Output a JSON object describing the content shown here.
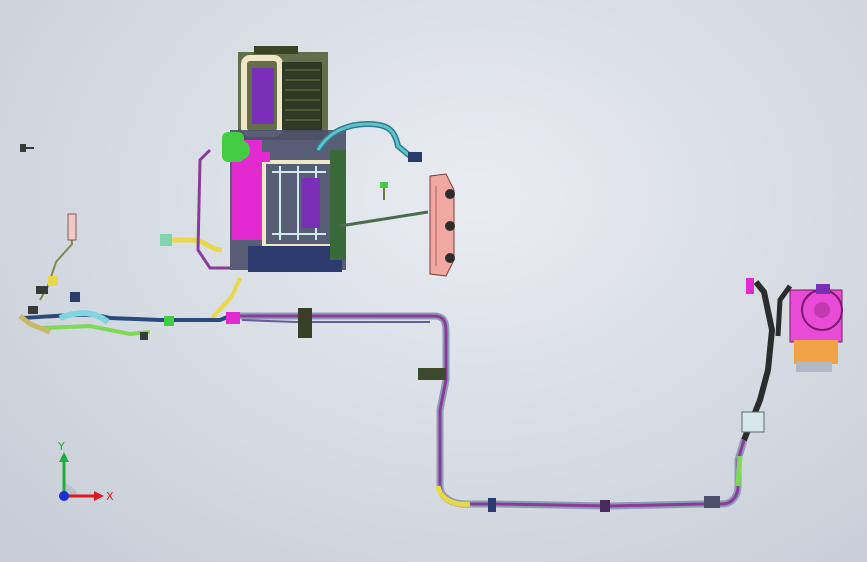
{
  "viewport": {
    "background_top": "#e9edf2",
    "background_bottom": "#c6ccd5"
  },
  "triad": {
    "y_label": "Y",
    "x_label": "X",
    "y_color": "#1fae3a",
    "x_color": "#e0191f",
    "z_color": "#1a2fd6"
  },
  "colors": {
    "hvac_purple": "#7a2fb8",
    "hvac_magenta": "#e22ad0",
    "hvac_green": "#44cc44",
    "hvac_frame": "#efe7c5",
    "pipe_purple": "#8a3c9a",
    "pipe_steel": "#8e9bb5",
    "hose_green": "#7ed957",
    "hose_cyan": "#7fd6e0",
    "compressor_pink": "#e84bd6",
    "compressor_orange": "#f2a345",
    "condenser_salmon": "#f0a8a0",
    "clip_yellow": "#e8d84a"
  },
  "icons": {
    "compressor": "compressor-icon",
    "hvac": "hvac-unit-icon",
    "condenser": "condenser-icon"
  }
}
